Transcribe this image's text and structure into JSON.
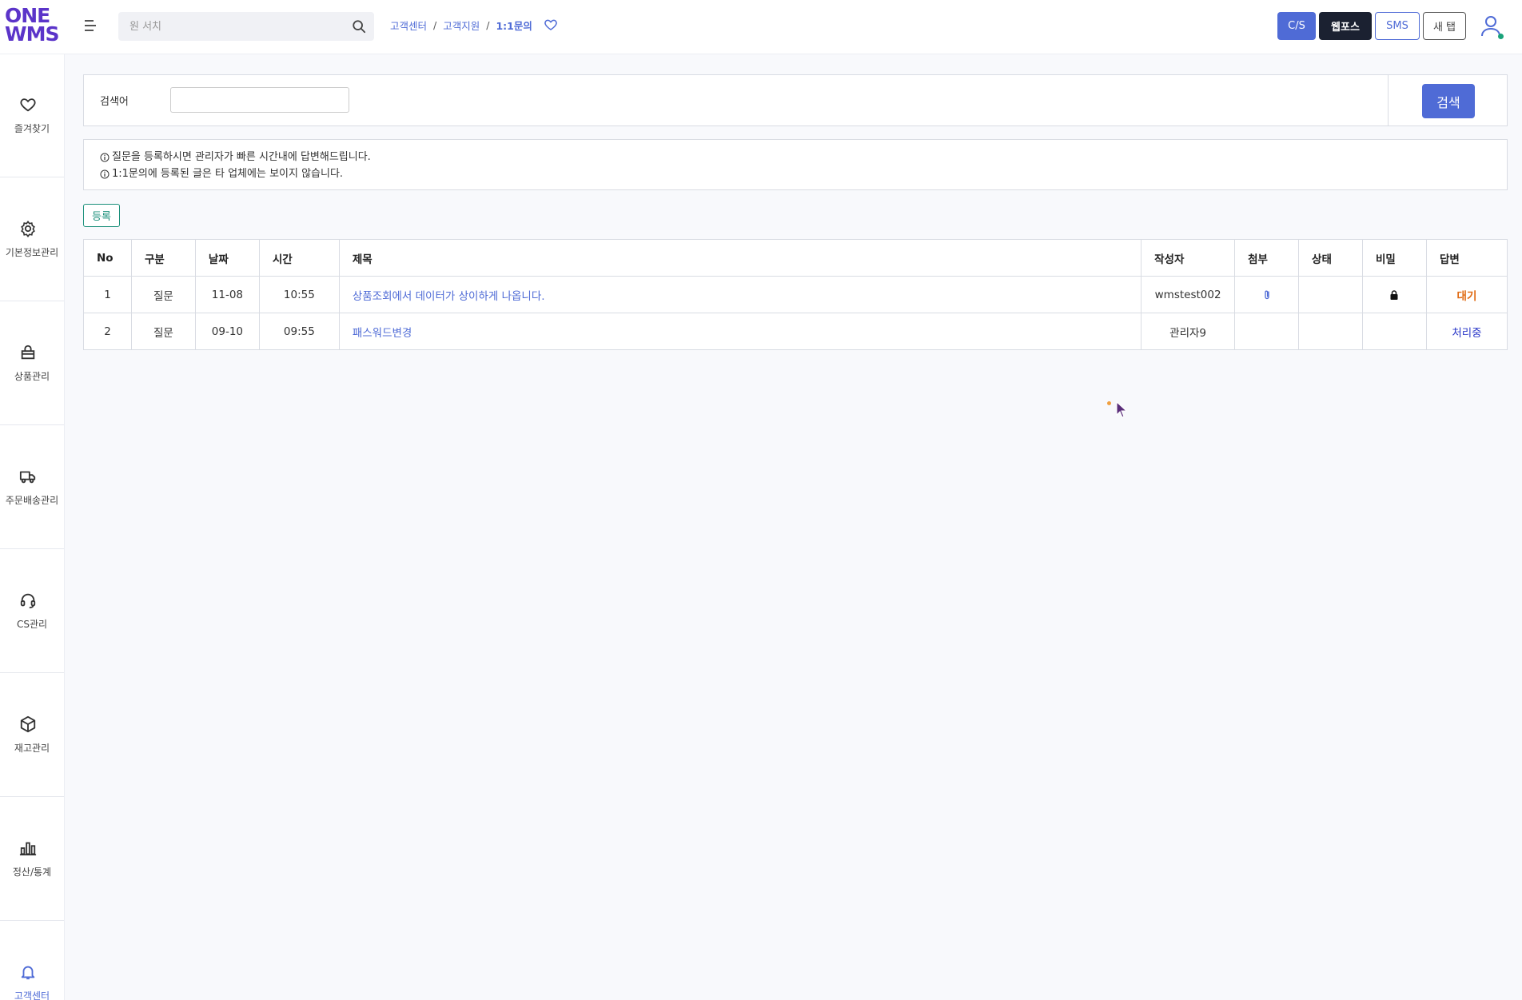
{
  "logo": {
    "line1": "ONE",
    "line2": "WMS"
  },
  "search": {
    "placeholder": "원 서치"
  },
  "breadcrumb": {
    "items": [
      "고객센터",
      "고객지원",
      "1:1문의"
    ],
    "sep": "/"
  },
  "top_buttons": {
    "cs": "C/S",
    "wp": "웹포스",
    "sms": "SMS",
    "newtab": "새 탭"
  },
  "sidebar": {
    "items": [
      {
        "label": "즐겨찾기",
        "icon": "heart-icon"
      },
      {
        "label": "기본정보관리",
        "icon": "gear-icon"
      },
      {
        "label": "상품관리",
        "icon": "bag-icon"
      },
      {
        "label": "주문배송관리",
        "icon": "truck-icon"
      },
      {
        "label": "CS관리",
        "icon": "headset-icon"
      },
      {
        "label": "재고관리",
        "icon": "box-icon"
      },
      {
        "label": "정산/통계",
        "icon": "bar-chart-icon"
      },
      {
        "label": "고객센터",
        "icon": "bell-icon"
      }
    ]
  },
  "filter": {
    "label": "검색어",
    "value": "",
    "button": "검색"
  },
  "notice": {
    "lines": [
      "질문을 등록하시면 관리자가 빠른 시간내에 답변해드립니다.",
      "1:1문의에 등록된 글은 타 업체에는 보이지 않습니다."
    ]
  },
  "register_button": "등록",
  "table": {
    "headers": [
      "No",
      "구분",
      "날짜",
      "시간",
      "제목",
      "작성자",
      "첨부",
      "상태",
      "비밀",
      "답변"
    ],
    "rows": [
      {
        "no": "1",
        "type": "질문",
        "date": "11-08",
        "time": "10:55",
        "title": "상품조회에서 데이터가 상이하게 나옵니다.",
        "author": "wmstest002",
        "attach": true,
        "status": "",
        "secret": true,
        "answer": "대기"
      },
      {
        "no": "2",
        "type": "질문",
        "date": "09-10",
        "time": "09:55",
        "title": "패스워드변경",
        "author": "관리자9",
        "attach": false,
        "status": "",
        "secret": false,
        "answer": "처리중"
      }
    ]
  },
  "colors": {
    "accent": "#4f6bd6",
    "brand": "#5b34c9",
    "wait": "#e06a12",
    "processing": "#2a37c8",
    "register": "#1a8f7a"
  }
}
